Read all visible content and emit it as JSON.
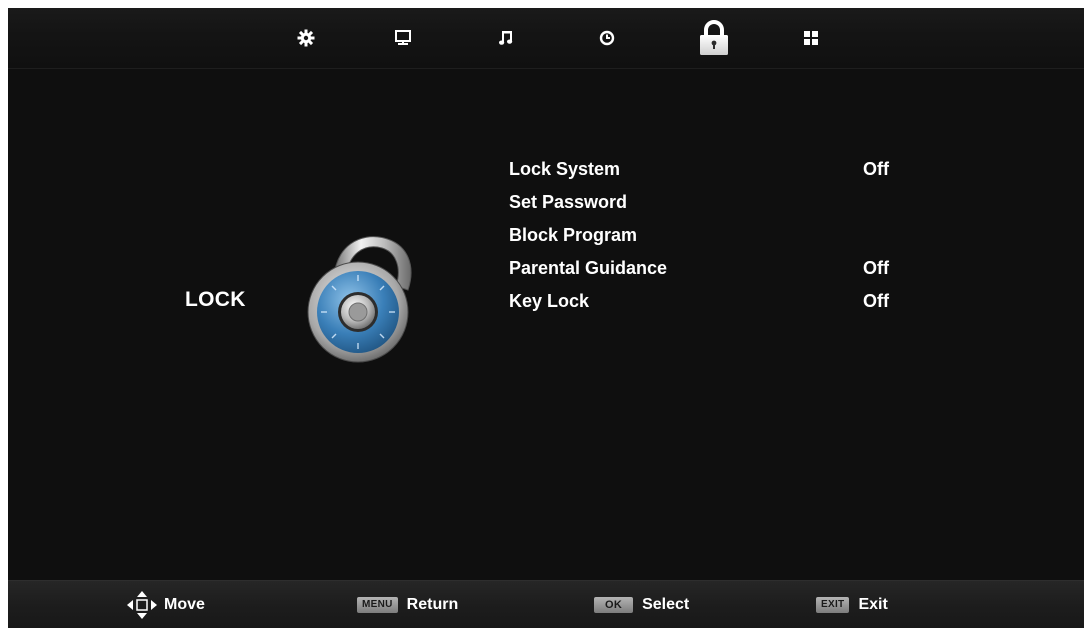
{
  "tabs": [
    {
      "name": "picture-settings-tab",
      "icon": "gear-icon"
    },
    {
      "name": "screen-tab",
      "icon": "monitor-icon"
    },
    {
      "name": "sound-tab",
      "icon": "music-note-icon"
    },
    {
      "name": "time-tab",
      "icon": "clock-icon"
    },
    {
      "name": "lock-tab",
      "icon": "padlock-icon",
      "selected": true
    },
    {
      "name": "setup-tab",
      "icon": "grid-icon"
    }
  ],
  "section": {
    "title": "LOCK",
    "icon": "combination-padlock-icon"
  },
  "menu": {
    "items": [
      {
        "label": "Lock System",
        "value": "Off"
      },
      {
        "label": "Set Password",
        "value": ""
      },
      {
        "label": "Block Program",
        "value": ""
      },
      {
        "label": "Parental Guidance",
        "value": "Off"
      },
      {
        "label": "Key Lock",
        "value": "Off"
      }
    ]
  },
  "help": {
    "move": {
      "icon": "dpad-arrows-icon",
      "label": "Move"
    },
    "return": {
      "key": "MENU",
      "label": "Return"
    },
    "select": {
      "key": "OK",
      "label": "Select"
    },
    "exit": {
      "key": "EXIT",
      "label": "Exit"
    }
  },
  "colors": {
    "background": "#0f0f0f",
    "text": "#ffffff",
    "lock_blue": "#3a7fb8",
    "keycap": "#9a9a9a"
  }
}
